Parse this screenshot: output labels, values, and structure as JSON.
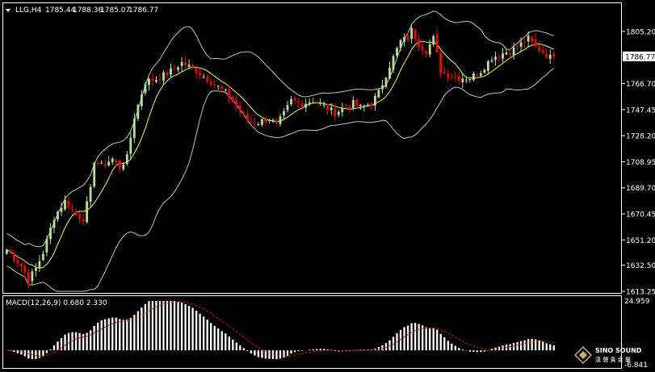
{
  "header": {
    "symbol": "LLG,H4",
    "open": "1785.44",
    "high": "1788.36",
    "low": "1785.07",
    "close": "1786.77"
  },
  "macd_label": "MACD(12,26,9) 0.680 2.330",
  "current_price_label": "1786.77",
  "logo": {
    "name": "SINO SOUND",
    "cn": "漢 聲 貴 金 屬"
  },
  "colors": {
    "background": "#000000",
    "bull_candle": "#b4e391",
    "bear_candle": "#ff0000",
    "bands": "#c0c0c0",
    "moving_average": "#ffff00",
    "macd_histogram": "#ffffff",
    "macd_signal": "#ff0000"
  },
  "chart_data": [
    {
      "type": "candlestick",
      "panel": "price",
      "overlays": [
        "bollinger-bands",
        "moving-average"
      ],
      "y_ticks": [
        1805.2,
        1786.77,
        1766.7,
        1747.45,
        1728.2,
        1708.95,
        1689.7,
        1670.45,
        1651.2,
        1632.5,
        1613.25
      ],
      "ylim": [
        1613.25,
        1813.5
      ],
      "keypoints": [
        [
          0,
          1644
        ],
        [
          4,
          1632
        ],
        [
          6,
          1622
        ],
        [
          8,
          1630
        ],
        [
          10,
          1642
        ],
        [
          13,
          1668
        ],
        [
          16,
          1680
        ],
        [
          19,
          1670
        ],
        [
          21,
          1667
        ],
        [
          23,
          1688
        ],
        [
          24,
          1710
        ],
        [
          26,
          1706
        ],
        [
          29,
          1711
        ],
        [
          31,
          1705
        ],
        [
          33,
          1712
        ],
        [
          35,
          1742
        ],
        [
          38,
          1768
        ],
        [
          41,
          1770
        ],
        [
          44,
          1774
        ],
        [
          48,
          1782
        ],
        [
          51,
          1778
        ],
        [
          54,
          1772
        ],
        [
          57,
          1766
        ],
        [
          60,
          1760
        ],
        [
          63,
          1750
        ],
        [
          66,
          1740
        ],
        [
          69,
          1738
        ],
        [
          72,
          1741
        ],
        [
          74,
          1736
        ],
        [
          76,
          1744
        ],
        [
          78,
          1754
        ],
        [
          81,
          1752
        ],
        [
          84,
          1754
        ],
        [
          87,
          1750
        ],
        [
          90,
          1745
        ],
        [
          92,
          1748
        ],
        [
          95,
          1752
        ],
        [
          97,
          1749
        ],
        [
          100,
          1752
        ],
        [
          102,
          1760
        ],
        [
          105,
          1780
        ],
        [
          108,
          1798
        ],
        [
          110,
          1800
        ],
        [
          111,
          1806
        ],
        [
          113,
          1796
        ],
        [
          115,
          1791
        ],
        [
          117,
          1800
        ],
        [
          119,
          1776
        ],
        [
          121,
          1773
        ],
        [
          124,
          1771
        ],
        [
          127,
          1771
        ],
        [
          130,
          1776
        ],
        [
          133,
          1786
        ],
        [
          136,
          1789
        ],
        [
          139,
          1792
        ],
        [
          141,
          1796
        ],
        [
          143,
          1800
        ],
        [
          145,
          1794
        ],
        [
          147,
          1790
        ],
        [
          149,
          1786
        ],
        [
          150,
          1787
        ]
      ]
    },
    {
      "type": "macd",
      "panel": "indicator",
      "params": [
        12,
        26,
        9
      ],
      "macd": 0.68,
      "signal": 2.33,
      "y_ticks": [
        24.959,
        -6.841
      ],
      "ylim": [
        -6.841,
        24.959
      ]
    }
  ]
}
